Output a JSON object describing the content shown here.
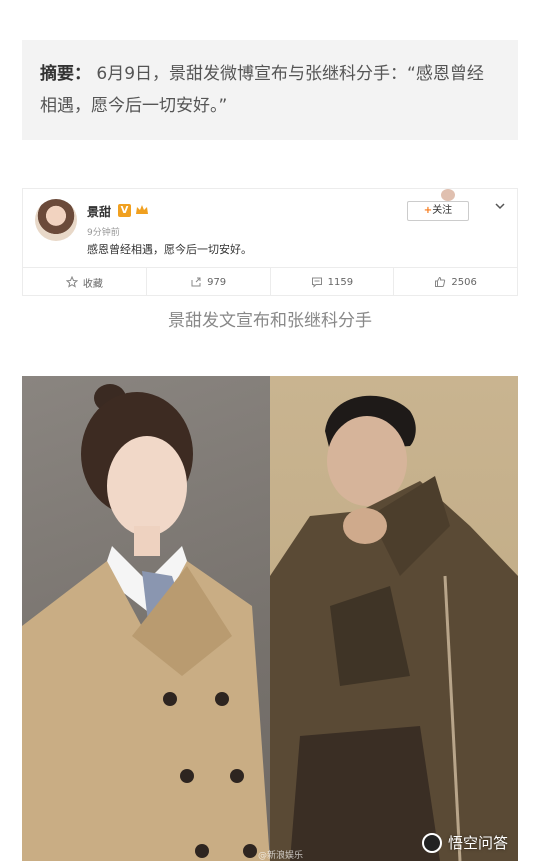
{
  "summary": {
    "label": "摘要：",
    "text": "6月9日，景甜发微博宣布与张继科分手：“感恩曾经相遇，愿今后一切安好。”"
  },
  "weibo": {
    "username": "景甜",
    "v_badge": "V",
    "time": "9分钟前",
    "post_text": "感恩曾经相遇，愿今后一切安好。",
    "follow_label": "关注",
    "follow_plus": "+",
    "actions": [
      {
        "icon": "star-icon",
        "label": "收藏"
      },
      {
        "icon": "share-icon",
        "label": "979"
      },
      {
        "icon": "comment-icon",
        "label": "1159"
      },
      {
        "icon": "thumbs-up-icon",
        "label": "2506"
      }
    ]
  },
  "caption": "景甜发文宣布和张继科分手",
  "photo": {
    "watermark": "悟空问答",
    "faint_watermark": "@新浪娱乐"
  },
  "colors": {
    "summary_bg": "#f3f3f3",
    "follow_accent": "#f77a1a",
    "v_badge": "#f0a020"
  }
}
